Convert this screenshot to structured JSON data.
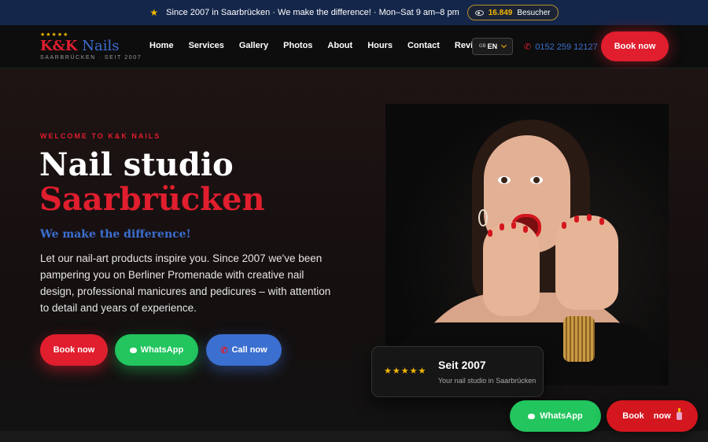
{
  "topbar": {
    "announcement": "Since 2007 in Saarbrücken · We make the difference! · Mon–Sat 9 am–8 pm",
    "visitor_count": "16.849",
    "visitor_label": "Besucher"
  },
  "logo": {
    "stars": "★★★★★",
    "name_kk": "K&K",
    "name_nails": " Nails",
    "tagline": "SAARBRÜCKEN · SEIT 2007"
  },
  "nav": {
    "items": [
      "Home",
      "Services",
      "Gallery",
      "Photos",
      "About",
      "Hours",
      "Contact",
      "Reviews"
    ],
    "language": "EN",
    "language_flag": "GB",
    "phone": "0152 259 12127",
    "book_label": "Book now"
  },
  "hero": {
    "eyebrow": "WELCOME TO K&K NAILS",
    "title_line1": "Nail studio",
    "title_line2": "Saarbrücken",
    "subhead": "We make the difference!",
    "description": "Let our nail-art products inspire you. Since 2007 we've been pampering you on Berliner Promenade with creative nail design, professional manicures and pedicures – with attention to detail and years of experience.",
    "book_label": "Book now",
    "whatsapp_label": "WhatsApp",
    "call_label": "Call now"
  },
  "seit_card": {
    "stars": "★★★★★",
    "title": "Seit 2007",
    "subtitle": "Your nail studio in Saarbrücken"
  },
  "floating": {
    "whatsapp_label": "WhatsApp",
    "book_label": "Book",
    "book_suffix": "now"
  },
  "colors": {
    "brand_red": "#e01e2e",
    "brand_blue": "#3b6fd0",
    "gold": "#f5b800",
    "whatsapp_green": "#22c55e",
    "topbar_navy": "#14264a"
  },
  "icons": [
    "star-icon",
    "eye-icon",
    "phone-icon",
    "chevron-down-icon",
    "chat-icon",
    "nail-polish-icon"
  ]
}
